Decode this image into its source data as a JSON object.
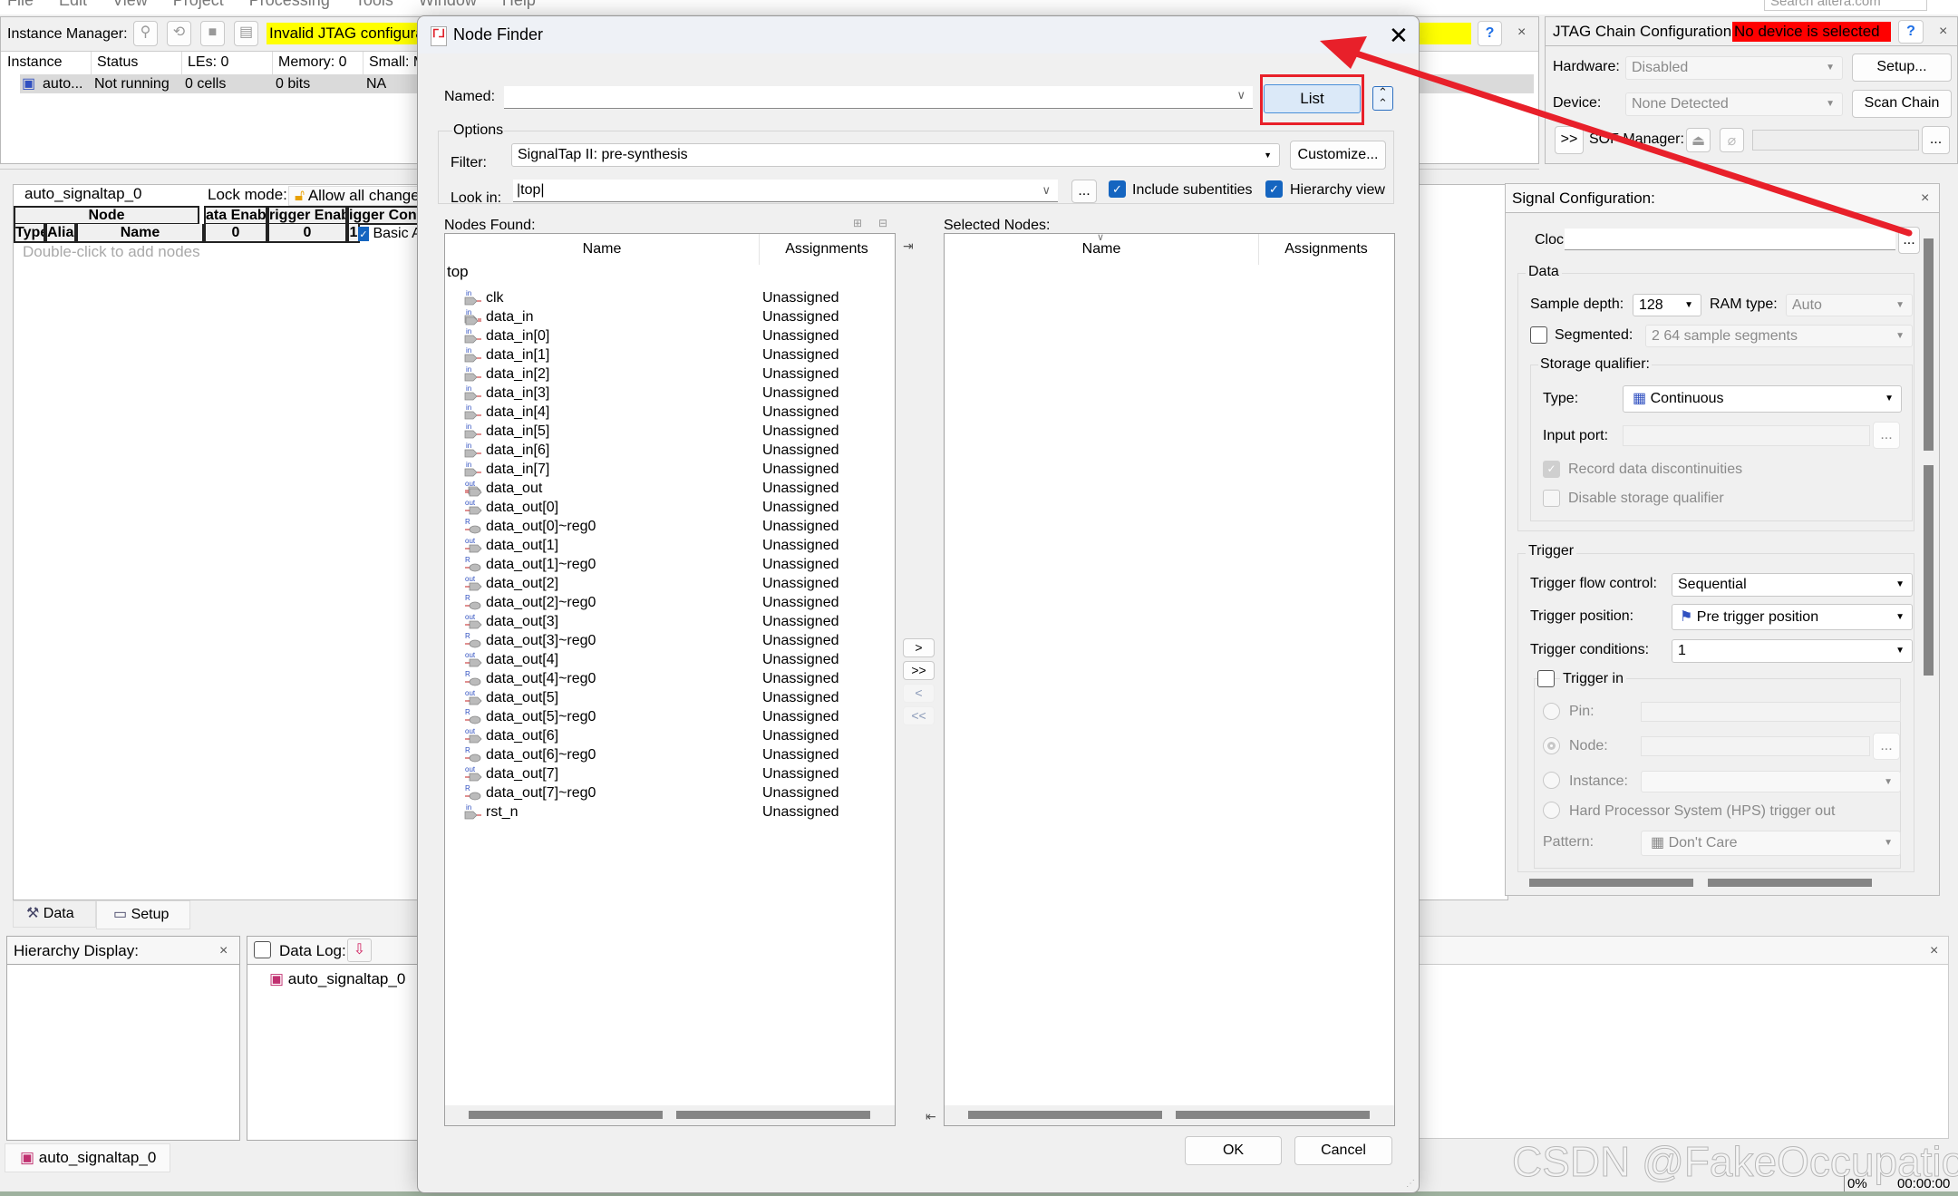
{
  "menu": [
    "File",
    "Edit",
    "View",
    "Project",
    "Processing",
    "Tools",
    "Window",
    "Help"
  ],
  "search_placeholder": "Search altera.com",
  "instance_manager": {
    "label": "Instance Manager:",
    "status": "Invalid JTAG configuration",
    "columns": [
      "Instance",
      "Status",
      "LEs: 0",
      "Memory: 0",
      "Small: M"
    ],
    "row": [
      "auto...",
      "Not running",
      "0 cells",
      "0 bits",
      "NA"
    ]
  },
  "setup_panel": {
    "instance": "auto_signaltap_0",
    "lock_mode_label": "Lock mode:",
    "lock_mode_value": "Allow all changes",
    "headers": [
      "Node",
      "ata Enab",
      "rigger Enab",
      "igger Cond"
    ],
    "subheaders": [
      "Type",
      "Alias",
      "Name",
      "0",
      "0",
      "1"
    ],
    "basic": "Basic AND",
    "hint": "Double-click to add nodes",
    "tabs": [
      "Data",
      "Setup"
    ]
  },
  "hierarchy": {
    "title": "Hierarchy Display:"
  },
  "datalog": {
    "title": "Data Log:",
    "item": "auto_signaltap_0"
  },
  "bottom_tab": "auto_signaltap_0",
  "jtag": {
    "title": "JTAG Chain Configuration:",
    "status": "No device is selected",
    "hardware_label": "Hardware:",
    "hardware_value": "Disabled",
    "setup_btn": "Setup...",
    "device_label": "Device:",
    "device_value": "None Detected",
    "scan_btn": "Scan Chain",
    "sof_toggle": ">>",
    "sof_label": "SOF Manager:",
    "sof_more": "..."
  },
  "signal_config": {
    "title": "Signal Configuration:",
    "clock_label": "Clock:",
    "clock_value": "",
    "clock_more": "...",
    "data_group": "Data",
    "sample_depth_label": "Sample depth:",
    "sample_depth": "128",
    "ram_type_label": "RAM type:",
    "ram_type": "Auto",
    "segmented_label": "Segmented:",
    "segmented_value": "2  64 sample segments",
    "segmented": false,
    "storage_group": "Storage qualifier:",
    "type_label": "Type:",
    "type_value": "Continuous",
    "input_port_label": "Input port:",
    "input_more": "...",
    "record_disc": "Record data discontinuities",
    "record_disc_checked": true,
    "disable_sq": "Disable storage qualifier",
    "trigger_group": "Trigger",
    "flow_label": "Trigger flow control:",
    "flow_value": "Sequential",
    "position_label": "Trigger position:",
    "position_value": "Pre trigger position",
    "conditions_label": "Trigger conditions:",
    "conditions_value": "1",
    "trigger_in": "Trigger in",
    "pin_label": "Pin:",
    "node_label": "Node:",
    "node_more": "...",
    "instance_label": "Instance:",
    "hps": "Hard Processor System (HPS) trigger out",
    "pattern_label": "Pattern:",
    "pattern_value": "Don't Care"
  },
  "dialog": {
    "title": "Node Finder",
    "named_label": "Named:",
    "named_value": "",
    "list_btn": "List",
    "options_label": "Options",
    "filter_label": "Filter:",
    "filter_value": "SignalTap II: pre-synthesis",
    "customize_btn": "Customize...",
    "lookin_label": "Look in:",
    "lookin_value": "|top|",
    "lookin_more": "...",
    "include_sub": "Include subentities",
    "include_sub_checked": true,
    "hier_view": "Hierarchy view",
    "hier_view_checked": true,
    "nodes_found_label": "Nodes Found:",
    "selected_nodes_label": "Selected Nodes:",
    "col_name": "Name",
    "col_assign": "Assignments",
    "root": "top",
    "nodes": [
      {
        "name": "clk",
        "type": "in",
        "assignment": "Unassigned"
      },
      {
        "name": "data_in",
        "type": "in-bus",
        "assignment": "Unassigned"
      },
      {
        "name": "data_in[0]",
        "type": "in",
        "assignment": "Unassigned"
      },
      {
        "name": "data_in[1]",
        "type": "in",
        "assignment": "Unassigned"
      },
      {
        "name": "data_in[2]",
        "type": "in",
        "assignment": "Unassigned"
      },
      {
        "name": "data_in[3]",
        "type": "in",
        "assignment": "Unassigned"
      },
      {
        "name": "data_in[4]",
        "type": "in",
        "assignment": "Unassigned"
      },
      {
        "name": "data_in[5]",
        "type": "in",
        "assignment": "Unassigned"
      },
      {
        "name": "data_in[6]",
        "type": "in",
        "assignment": "Unassigned"
      },
      {
        "name": "data_in[7]",
        "type": "in",
        "assignment": "Unassigned"
      },
      {
        "name": "data_out",
        "type": "out-bus",
        "assignment": "Unassigned"
      },
      {
        "name": "data_out[0]",
        "type": "out",
        "assignment": "Unassigned"
      },
      {
        "name": "data_out[0]~reg0",
        "type": "reg",
        "assignment": "Unassigned"
      },
      {
        "name": "data_out[1]",
        "type": "out",
        "assignment": "Unassigned"
      },
      {
        "name": "data_out[1]~reg0",
        "type": "reg",
        "assignment": "Unassigned"
      },
      {
        "name": "data_out[2]",
        "type": "out",
        "assignment": "Unassigned"
      },
      {
        "name": "data_out[2]~reg0",
        "type": "reg",
        "assignment": "Unassigned"
      },
      {
        "name": "data_out[3]",
        "type": "out",
        "assignment": "Unassigned"
      },
      {
        "name": "data_out[3]~reg0",
        "type": "reg",
        "assignment": "Unassigned"
      },
      {
        "name": "data_out[4]",
        "type": "out",
        "assignment": "Unassigned"
      },
      {
        "name": "data_out[4]~reg0",
        "type": "reg",
        "assignment": "Unassigned"
      },
      {
        "name": "data_out[5]",
        "type": "out",
        "assignment": "Unassigned"
      },
      {
        "name": "data_out[5]~reg0",
        "type": "reg",
        "assignment": "Unassigned"
      },
      {
        "name": "data_out[6]",
        "type": "out",
        "assignment": "Unassigned"
      },
      {
        "name": "data_out[6]~reg0",
        "type": "reg",
        "assignment": "Unassigned"
      },
      {
        "name": "data_out[7]",
        "type": "out",
        "assignment": "Unassigned"
      },
      {
        "name": "data_out[7]~reg0",
        "type": "reg",
        "assignment": "Unassigned"
      },
      {
        "name": "rst_n",
        "type": "in",
        "assignment": "Unassigned"
      }
    ],
    "move_buttons": [
      ">",
      ">>",
      "<",
      "<<"
    ],
    "ok_btn": "OK",
    "cancel_btn": "Cancel"
  },
  "status_bar": {
    "progress": "0%",
    "time": "00:00:00"
  },
  "watermark": "CSDN @FakeOccupational",
  "colors": {
    "yellow_status": "#ffff00",
    "red_status": "#ff0000",
    "annotation_red": "#e8202a",
    "checkbox_blue": "#1565c0"
  }
}
